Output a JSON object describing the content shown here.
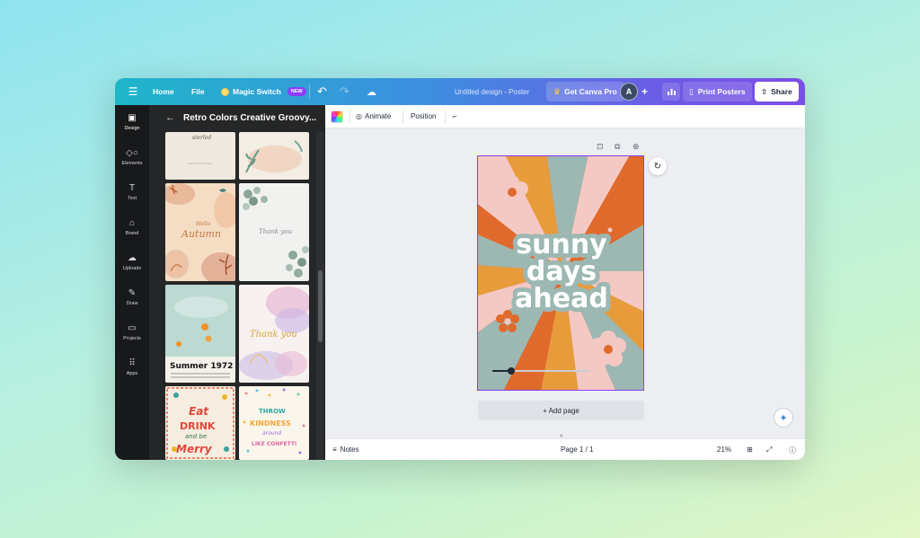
{
  "topbar": {
    "home": "Home",
    "file": "File",
    "magic_switch": "Magic Switch",
    "new_badge": "NEW",
    "doc_title": "Untitled design - Poster",
    "get_pro": "Get Canva Pro",
    "avatar_letter": "A",
    "print": "Print Posters",
    "share": "Share"
  },
  "rail": {
    "items": [
      {
        "label": "Design",
        "icon": "design-icon"
      },
      {
        "label": "Elements",
        "icon": "elements-icon"
      },
      {
        "label": "Text",
        "icon": "text-icon"
      },
      {
        "label": "Brand",
        "icon": "brand-icon"
      },
      {
        "label": "Uploads",
        "icon": "uploads-icon"
      },
      {
        "label": "Draw",
        "icon": "draw-icon"
      },
      {
        "label": "Projects",
        "icon": "projects-icon"
      },
      {
        "label": "Apps",
        "icon": "apps-icon"
      }
    ]
  },
  "panel": {
    "title": "Retro Colors Creative Groovy...",
    "templates": [
      {
        "text": "Hello Autumn"
      },
      {
        "text": "Thank you"
      },
      {
        "text": "Thank you"
      },
      {
        "text": "Summer 1972"
      },
      {
        "text": "Eat DRINK and be Merry"
      },
      {
        "text": "THROW KINDNESS around LIKE CONFETTI"
      }
    ]
  },
  "toolbar": {
    "animate": "Animate",
    "position": "Position"
  },
  "poster": {
    "line1": "sunny",
    "line2": "days",
    "line3": "ahead",
    "colors": {
      "orange": "#e06a2c",
      "gold": "#e79b3b",
      "pink": "#f4c9c4",
      "sage": "#9db8b2",
      "cream": "#f7e6d0"
    }
  },
  "canvas": {
    "add_page": "+ Add page"
  },
  "footer": {
    "notes": "Notes",
    "page": "Page 1 / 1",
    "zoom": "21%"
  }
}
